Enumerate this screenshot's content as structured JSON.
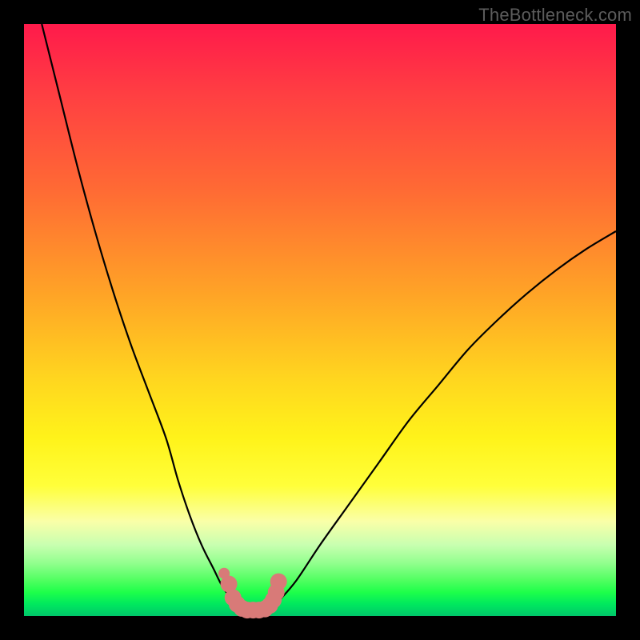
{
  "watermark": "TheBottleneck.com",
  "colors": {
    "curve_stroke": "#000000",
    "marker_fill": "#d87a78",
    "marker_stroke": "#d87a78"
  },
  "chart_data": {
    "type": "line",
    "title": "",
    "xlabel": "",
    "ylabel": "",
    "xlim": [
      0,
      100
    ],
    "ylim": [
      0,
      100
    ],
    "grid": false,
    "series": [
      {
        "name": "left-curve",
        "x": [
          3,
          6,
          9,
          12,
          15,
          18,
          21,
          24,
          26,
          28,
          30,
          32,
          33.5,
          35,
          36
        ],
        "y": [
          100,
          88,
          76,
          65,
          55,
          46,
          38,
          30,
          23,
          17,
          12,
          8,
          5,
          3,
          2
        ]
      },
      {
        "name": "trough",
        "x": [
          36,
          37.5,
          39,
          40.5,
          42,
          43
        ],
        "y": [
          2,
          1,
          1,
          1,
          1.5,
          2.5
        ]
      },
      {
        "name": "right-curve",
        "x": [
          43,
          46,
          50,
          55,
          60,
          65,
          70,
          75,
          80,
          85,
          90,
          95,
          100
        ],
        "y": [
          2.5,
          6,
          12,
          19,
          26,
          33,
          39,
          45,
          50,
          54.5,
          58.5,
          62,
          65
        ]
      }
    ],
    "markers": {
      "name": "salmon-dots",
      "x": [
        33.8,
        34.6,
        35.3,
        36.0,
        36.8,
        37.7,
        38.7,
        39.7,
        40.7,
        41.5,
        42.1,
        42.6,
        43.0
      ],
      "y": [
        7.2,
        5.4,
        3.1,
        2.0,
        1.3,
        1.0,
        1.0,
        1.0,
        1.2,
        1.8,
        2.7,
        4.0,
        5.8
      ]
    }
  }
}
